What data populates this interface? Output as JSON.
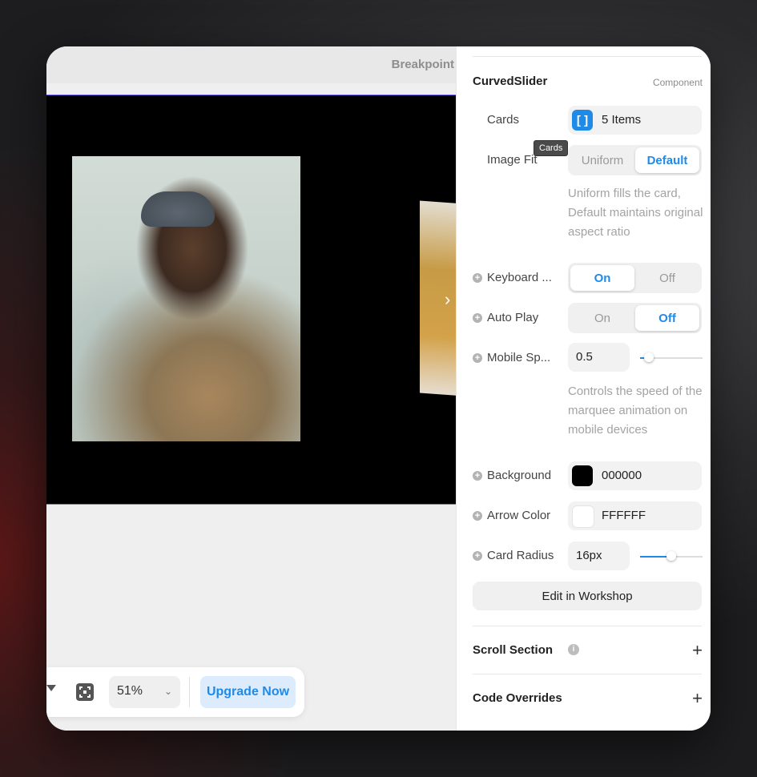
{
  "canvas": {
    "breakpoint_label": "Breakpoint",
    "zoom": "51%",
    "upgrade_label": "Upgrade Now"
  },
  "panel": {
    "title": "CurvedSlider",
    "badge": "Component",
    "cards": {
      "label": "Cards",
      "value": "5 Items",
      "tooltip": "Cards"
    },
    "image_fit": {
      "label": "Image Fit",
      "options": [
        "Uniform",
        "Default"
      ],
      "selected": "Default",
      "description": "Uniform fills the card, Default maintains original aspect ratio"
    },
    "keyboard": {
      "label": "Keyboard ...",
      "options": [
        "On",
        "Off"
      ],
      "selected": "On"
    },
    "auto_play": {
      "label": "Auto Play",
      "options": [
        "On",
        "Off"
      ],
      "selected": "Off"
    },
    "mobile_speed": {
      "label": "Mobile Sp...",
      "value": "0.5",
      "slider_fraction": 0.14,
      "description": "Controls the speed of the marquee animation on mobile devices"
    },
    "background": {
      "label": "Background",
      "value": "000000",
      "color": "#000000"
    },
    "arrow_color": {
      "label": "Arrow Color",
      "value": "FFFFFF",
      "color": "#FFFFFF"
    },
    "card_radius": {
      "label": "Card Radius",
      "value": "16px",
      "slider_fraction": 0.5
    },
    "edit_button": "Edit in Workshop",
    "sections": [
      {
        "title": "Scroll Section",
        "has_info": true
      },
      {
        "title": "Code Overrides",
        "has_info": false
      }
    ]
  },
  "accent_color": "#1f8ae8"
}
